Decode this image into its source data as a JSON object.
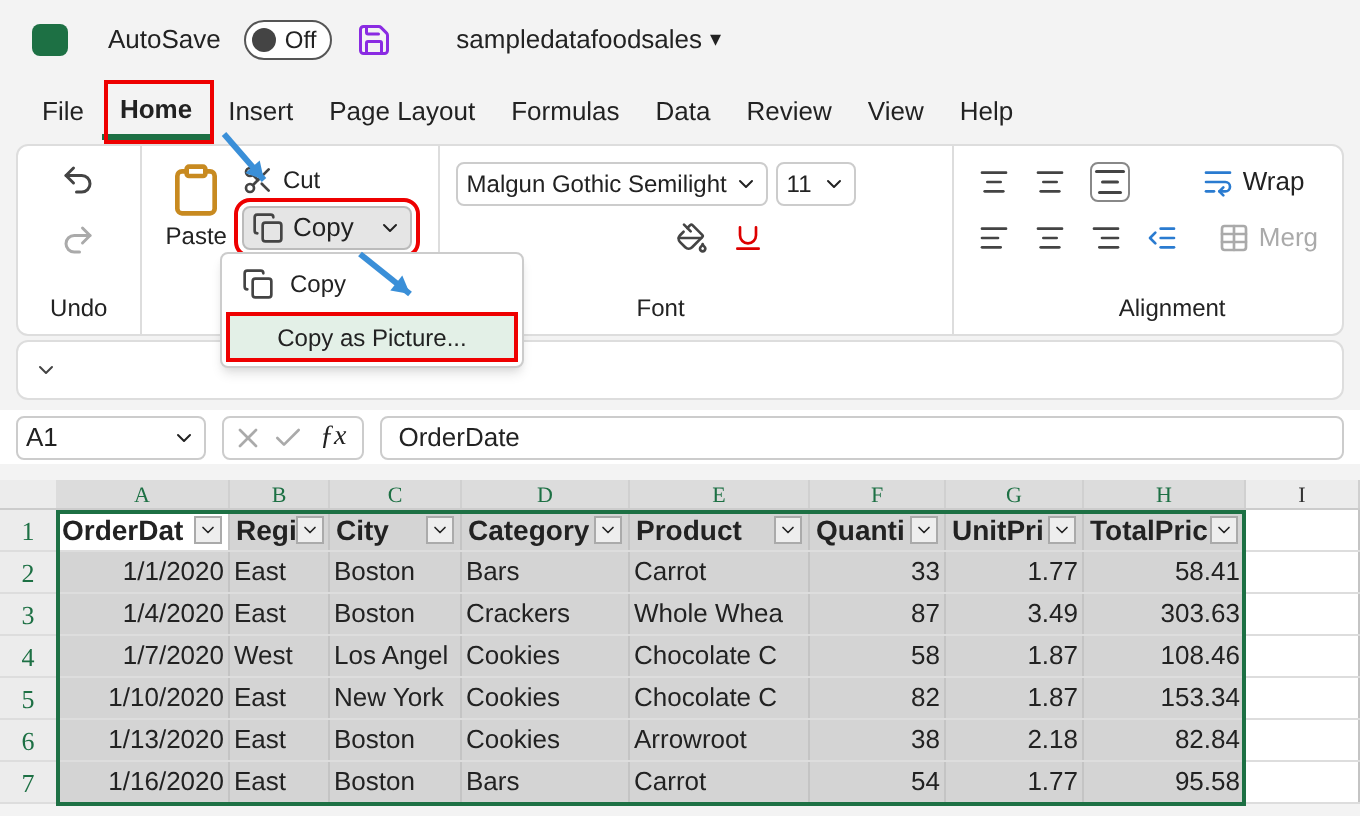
{
  "app": {
    "title": "sampledatafoodsales",
    "title_menu": "▾",
    "autosave": {
      "label": "AutoSave",
      "on": false,
      "state_text": "Off"
    }
  },
  "tabs": [
    {
      "label": "File",
      "selected": false
    },
    {
      "label": "Home",
      "selected": true
    },
    {
      "label": "Insert",
      "selected": false
    },
    {
      "label": "Page Layout",
      "selected": false
    },
    {
      "label": "Formulas",
      "selected": false
    },
    {
      "label": "Data",
      "selected": false
    },
    {
      "label": "Review",
      "selected": false
    },
    {
      "label": "View",
      "selected": false
    },
    {
      "label": "Help",
      "selected": false
    }
  ],
  "ribbon": {
    "undo_group": "Undo",
    "clipboard": {
      "paste": "Paste",
      "cut": "Cut",
      "copy": "Copy"
    },
    "font": {
      "name": "Malgun Gothic Semilight",
      "size": "11",
      "group": "Font"
    },
    "alignment": {
      "wrap": "Wrap",
      "merge": "Merg",
      "merge_disabled": true,
      "group": "Alignment"
    }
  },
  "copy_menu": {
    "items": [
      {
        "label": "Copy",
        "selected": false
      },
      {
        "label": "Copy as Picture...",
        "selected": true
      }
    ]
  },
  "formula_bar": {
    "name_box": "A1",
    "function_label": "ƒx",
    "value": "OrderDate"
  },
  "sheet": {
    "columns": [
      {
        "letter": "A",
        "kind": "number"
      },
      {
        "letter": "B",
        "kind": "text"
      },
      {
        "letter": "C",
        "kind": "text"
      },
      {
        "letter": "D",
        "kind": "text"
      },
      {
        "letter": "E",
        "kind": "text"
      },
      {
        "letter": "F",
        "kind": "number"
      },
      {
        "letter": "G",
        "kind": "number"
      },
      {
        "letter": "H",
        "kind": "number"
      },
      {
        "letter": "I",
        "kind": "text"
      }
    ],
    "header_row_number": "1",
    "headers": [
      "OrderDat",
      "Regi",
      "City",
      "Category",
      "Product",
      "Quanti",
      "UnitPri",
      "TotalPric"
    ],
    "rows": [
      {
        "number": "2",
        "selected": true,
        "cells": [
          "1/1/2020",
          "East",
          "Boston",
          "Bars",
          "Carrot",
          "33",
          "1.77",
          "58.41"
        ]
      },
      {
        "number": "3",
        "selected": true,
        "cells": [
          "1/4/2020",
          "East",
          "Boston",
          "Crackers",
          "Whole Whea",
          "87",
          "3.49",
          "303.63"
        ]
      },
      {
        "number": "4",
        "selected": true,
        "cells": [
          "1/7/2020",
          "West",
          "Los Angel",
          "Cookies",
          "Chocolate C",
          "58",
          "1.87",
          "108.46"
        ]
      },
      {
        "number": "5",
        "selected": true,
        "cells": [
          "1/10/2020",
          "East",
          "New York",
          "Cookies",
          "Chocolate C",
          "82",
          "1.87",
          "153.34"
        ]
      },
      {
        "number": "6",
        "selected": true,
        "cells": [
          "1/13/2020",
          "East",
          "Boston",
          "Cookies",
          "Arrowroot",
          "38",
          "2.18",
          "82.84"
        ]
      },
      {
        "number": "7",
        "selected": true,
        "cells": [
          "1/16/2020",
          "East",
          "Boston",
          "Bars",
          "Carrot",
          "54",
          "1.77",
          "95.58"
        ]
      }
    ]
  }
}
